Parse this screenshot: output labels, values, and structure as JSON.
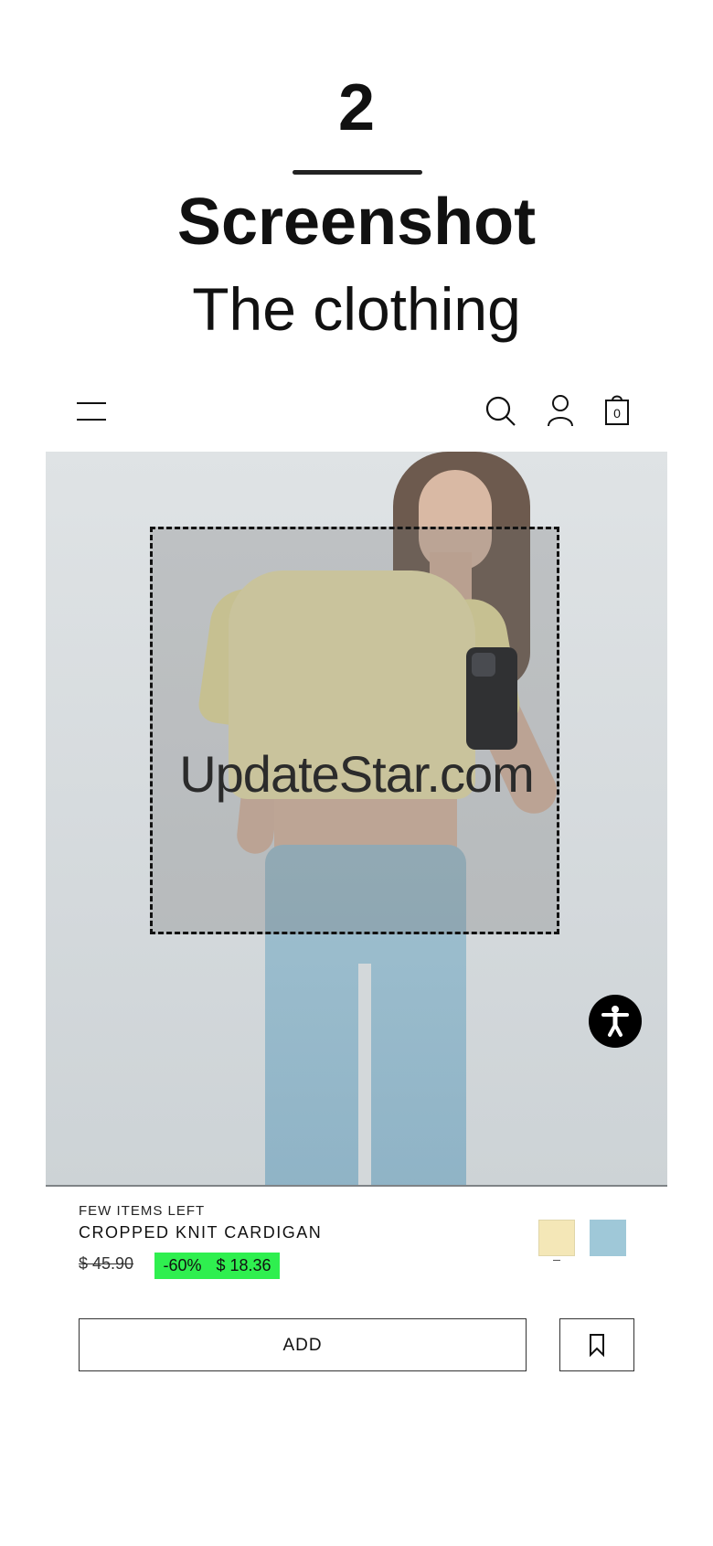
{
  "hero": {
    "number": "2",
    "title": "Screenshot",
    "subtitle": "The clothing"
  },
  "nav": {
    "bag_count": "0",
    "icons": [
      "menu-icon",
      "search-icon",
      "user-icon",
      "bag-icon"
    ]
  },
  "image": {
    "watermark": "UpdateStar.com"
  },
  "product": {
    "stock_label": "FEW ITEMS LEFT",
    "name": "CROPPED KNIT CARDIGAN",
    "old_price": "$ 45.90",
    "discount": "-60%",
    "sale_price": "$ 18.36",
    "swatch_colors": [
      "#f4e7b7",
      "#9fc8d8"
    ],
    "sale_color": "#2fef4f"
  },
  "actions": {
    "add_label": "ADD"
  }
}
